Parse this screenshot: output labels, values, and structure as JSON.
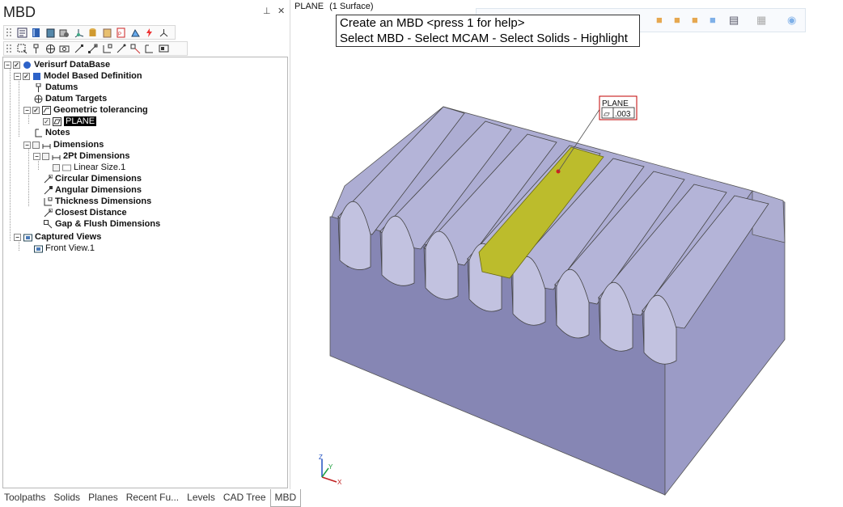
{
  "panel": {
    "title": "MBD",
    "pin_glyph": "📌",
    "close_glyph": "✕"
  },
  "toolbar1": {
    "icons": [
      "list-check-icon",
      "book-icon",
      "box-icon",
      "gear-box-icon",
      "csys-icon",
      "cylinder-icon",
      "layers-icon",
      "pdf-icon",
      "datum-icon",
      "lightning-icon",
      "axis-icon"
    ]
  },
  "toolbar2": {
    "icons": [
      "zoom-region-icon",
      "datum-pin-icon",
      "circle-target-icon",
      "measure-icon",
      "dim-icon",
      "dim-angle-icon",
      "dim-thick-icon",
      "dim-close-icon",
      "dim-gap-icon",
      "dim-note-icon",
      "view-capture-icon"
    ]
  },
  "tree": {
    "root": "Verisurf DataBase",
    "mbd": "Model Based Definition",
    "datums": "Datums",
    "datum_targets": "Datum Targets",
    "geo_tol": "Geometric tolerancing",
    "plane": "PLANE",
    "notes": "Notes",
    "dimensions": "Dimensions",
    "two_pt": "2Pt Dimensions",
    "linear_size": "Linear Size.1",
    "circular": "Circular Dimensions",
    "angular": "Angular Dimensions",
    "thickness": "Thickness Dimensions",
    "closest": "Closest Distance",
    "gap": "Gap & Flush Dimensions",
    "captured": "Captured Views",
    "front_view": "Front View.1"
  },
  "tabs": [
    "Toolpaths",
    "Solids",
    "Planes",
    "Recent Fu...",
    "Levels",
    "CAD Tree",
    "MBD"
  ],
  "active_tab": "MBD",
  "viewport": {
    "status_name": "PLANE",
    "status_detail": "(1 Surface)",
    "prompt_line1": "Create an MBD <press 1 for help>",
    "prompt_line2": "Select MBD - Select MCAM - Select Solids - Highlight",
    "callout_label": "PLANE",
    "callout_symbol": "▱",
    "callout_value": ".003",
    "axis_x": "X",
    "axis_y": "Y",
    "axis_z": "Z"
  },
  "colors": {
    "part_top": "#b8b8d6",
    "part_front": "#8585b3",
    "part_side": "#9d9dc6",
    "highlight": "#bdbd2a",
    "callout_border": "#c00000"
  }
}
